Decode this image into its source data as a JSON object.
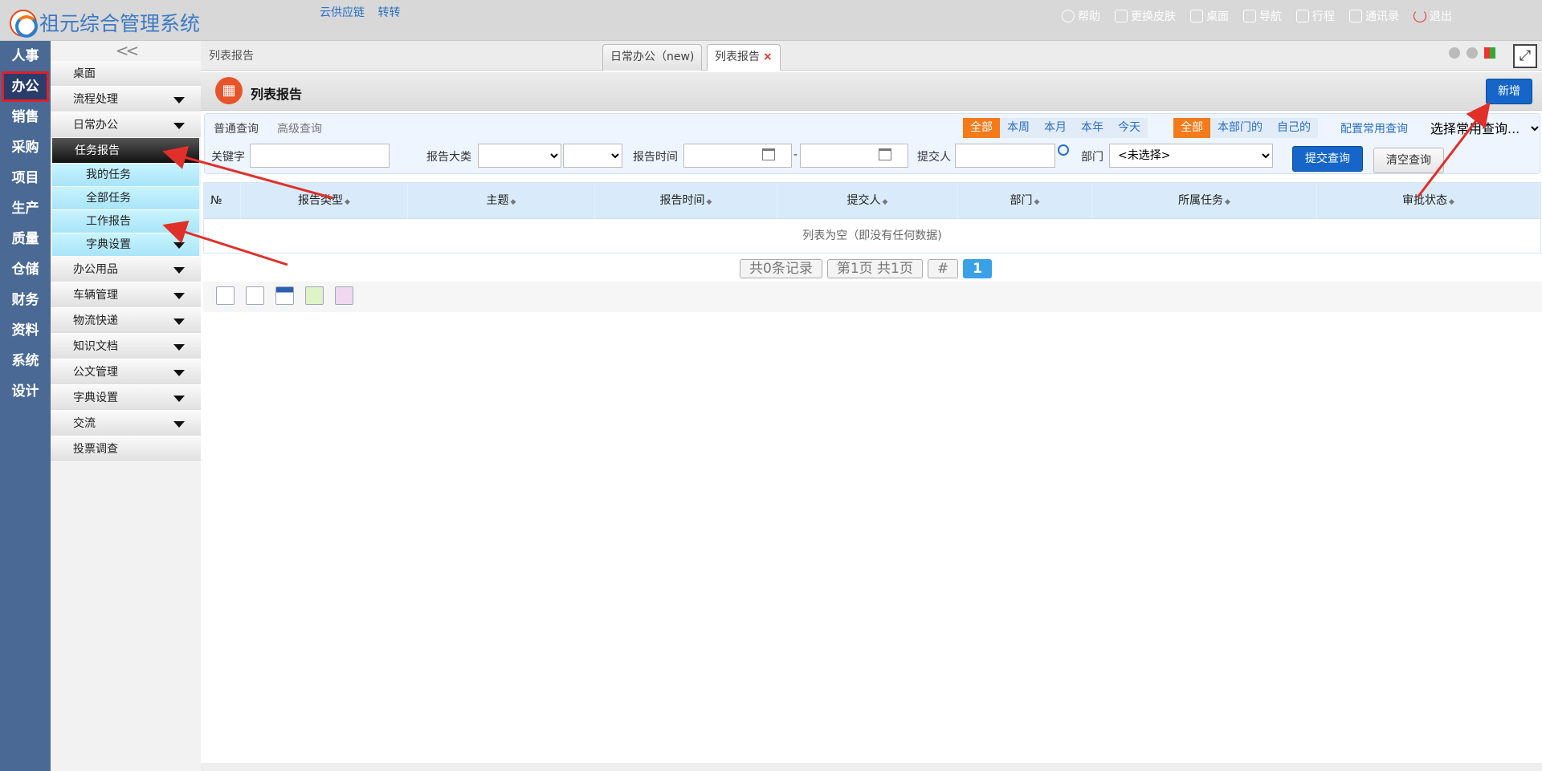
{
  "app": {
    "name": "祖元综合管理系统",
    "links": [
      "云供应链",
      "转转"
    ]
  },
  "top_menu": [
    {
      "label": "帮助",
      "icon": "help-icon"
    },
    {
      "label": "更换皮肤",
      "icon": "shirt-icon"
    },
    {
      "label": "桌面",
      "icon": "home-icon"
    },
    {
      "label": "导航",
      "icon": "grid-icon"
    },
    {
      "label": "行程",
      "icon": "calendar-icon"
    },
    {
      "label": "通讯录",
      "icon": "contacts-icon"
    },
    {
      "label": "退出",
      "icon": "power-icon"
    }
  ],
  "left_nav": [
    "人事",
    "办公",
    "销售",
    "采购",
    "项目",
    "生产",
    "质量",
    "仓储",
    "财务",
    "资料",
    "系统",
    "设计"
  ],
  "left_nav_active": "办公",
  "sidebar": {
    "collapse_glyph": "<<",
    "items": [
      {
        "label": "桌面"
      },
      {
        "label": "流程处理",
        "expand": true
      },
      {
        "label": "日常办公",
        "expand": true
      },
      {
        "label": "任务报告",
        "active": true
      },
      {
        "label": "我的任务",
        "sub": true
      },
      {
        "label": "全部任务",
        "sub": true
      },
      {
        "label": "工作报告",
        "sub": true
      },
      {
        "label": "字典设置",
        "sub": true,
        "expand": true
      },
      {
        "label": "办公用品",
        "expand": true
      },
      {
        "label": "车辆管理",
        "expand": true
      },
      {
        "label": "物流快递",
        "expand": true
      },
      {
        "label": "知识文档",
        "expand": true
      },
      {
        "label": "公文管理",
        "expand": true
      },
      {
        "label": "字典设置",
        "expand": true
      },
      {
        "label": "交流",
        "expand": true
      },
      {
        "label": "投票调查"
      }
    ]
  },
  "tabs": {
    "breadcrumb": "列表报告",
    "items": [
      {
        "label": "日常办公（new)"
      },
      {
        "label": "列表报告",
        "close": "×"
      }
    ],
    "fullscreen_glyph": "⤢"
  },
  "header": {
    "title": "列表报告",
    "add_label": "新增"
  },
  "query": {
    "normal_tab": "普通查询",
    "advanced_tab": "高级查询",
    "time_filters": [
      "全部",
      "本周",
      "本月",
      "本年",
      "今天"
    ],
    "scope_filters": [
      "全部",
      "本部门的",
      "自己的"
    ],
    "config_link": "配置常用查询",
    "common_select": "选择常用查询...",
    "keyword_label": "关键字",
    "category_label": "报告大类",
    "time_label": "报告时间",
    "dash": "-",
    "submitter_label": "提交人",
    "dept_label": "部门",
    "dept_value": "<未选择>",
    "submit_label": "提交查询",
    "clear_label": "清空查询"
  },
  "table": {
    "columns": [
      "№",
      "报告类型",
      "主题",
      "报告时间",
      "提交人",
      "部门",
      "所属任务",
      "审批状态"
    ],
    "empty_text": "列表为空（即没有任何数据)"
  },
  "pager": {
    "total": "共0条记录",
    "pages": "第1页 共1页",
    "hash": "#",
    "current": "1"
  },
  "colors": {
    "accent_blue": "#1566c8",
    "accent_orange": "#f47a1a",
    "left_nav": "#4a6a95",
    "annotation_red": "#e0302a"
  }
}
